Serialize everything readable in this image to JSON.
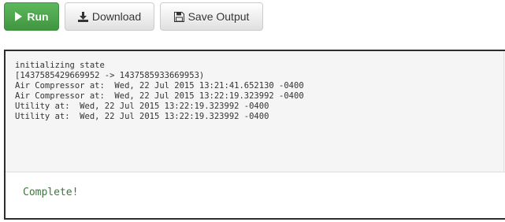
{
  "toolbar": {
    "run_label": "Run",
    "run_icon": "play-icon",
    "download_label": "Download",
    "download_icon": "download-icon",
    "save_label": "Save Output",
    "save_icon": "floppy-disk-icon"
  },
  "output": {
    "lines": [
      "initializing state",
      "[1437585429669952 -> 1437585933669953)",
      "Air Compressor at:  Wed, 22 Jul 2015 13:21:41.652130 -0400",
      "Air Compressor at:  Wed, 22 Jul 2015 13:22:19.323992 -0400",
      "Utility at:  Wed, 22 Jul 2015 13:22:19.323992 -0400",
      "Utility at:  Wed, 22 Jul 2015 13:22:19.323992 -0400"
    ],
    "status": "Complete!"
  },
  "colors": {
    "run_button": "#5cb85c",
    "status_text": "#3c763d",
    "panel_border": "#2e2e2e",
    "log_background": "#f5f5f5"
  }
}
